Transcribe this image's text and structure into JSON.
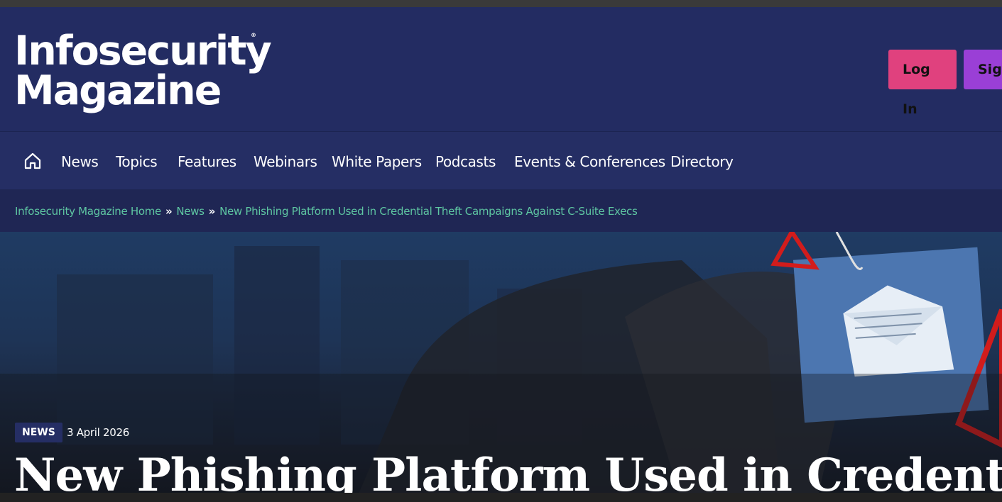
{
  "brand": {
    "logo_line1": "Infosecurity",
    "logo_line2": "Magazine",
    "registered_mark": "®"
  },
  "header": {
    "login_label": "Log In",
    "signup_label": "Sign"
  },
  "nav": {
    "home_icon": "home-icon",
    "items": [
      "News",
      "Topics",
      "Features",
      "Webinars",
      "White Papers",
      "Podcasts",
      "Events & Conferences",
      "Directory"
    ]
  },
  "breadcrumb": {
    "items": [
      "Infosecurity Magazine Home",
      "News",
      "New Phishing Platform Used in Credential Theft Campaigns Against C-Suite Execs"
    ],
    "separator": "»"
  },
  "article": {
    "category": "NEWS",
    "date": "3 April 2026",
    "title": "New Phishing Platform Used in Credential"
  },
  "colors": {
    "header_bg": "#232c62",
    "login_button": "#e0417e",
    "signup_button": "#9a3fd6",
    "breadcrumb_link": "#5ec6a2"
  }
}
